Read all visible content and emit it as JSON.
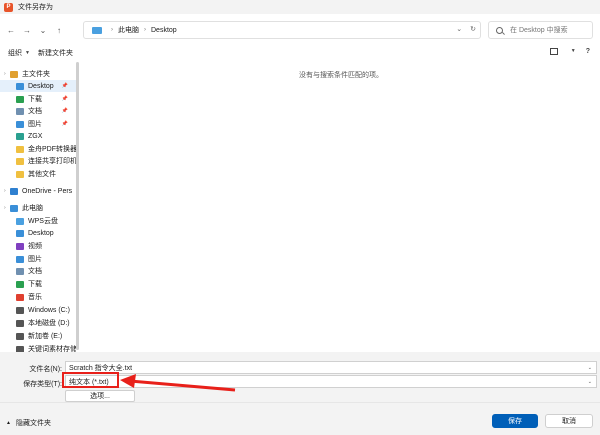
{
  "window": {
    "title": "文件另存为",
    "app_icon_letter": "P"
  },
  "nav": {
    "back": "←",
    "forward": "→",
    "dropdown": "⌄",
    "up": "↑",
    "breadcrumb": [
      "此电脑",
      "Desktop"
    ],
    "addr_dropdown": "⌄",
    "refresh": "↻",
    "search_placeholder": "在 Desktop 中搜索"
  },
  "toolbar": {
    "organize": "组织",
    "new_folder": "新建文件夹",
    "help": "?"
  },
  "sidebar": {
    "items": [
      {
        "label": "主文件夹",
        "icon": "home-icon",
        "color": "#e0a030"
      },
      {
        "label": "Desktop",
        "icon": "desktop-icon",
        "color": "#3a8fd8",
        "pinned": true,
        "selected": true
      },
      {
        "label": "下载",
        "icon": "download-icon",
        "color": "#2aa050",
        "pinned": true
      },
      {
        "label": "文档",
        "icon": "document-icon",
        "color": "#7090b0",
        "pinned": true
      },
      {
        "label": "图片",
        "icon": "pictures-icon",
        "color": "#3a8fd8",
        "pinned": true
      },
      {
        "label": "ZGX",
        "icon": "folder-icon",
        "color": "#2aa090"
      },
      {
        "label": "金舟PDF转换器",
        "icon": "folder-icon",
        "color": "#f0c040"
      },
      {
        "label": "连接共享打印机",
        "icon": "folder-icon",
        "color": "#f0c040"
      },
      {
        "label": "其他文件",
        "icon": "folder-icon",
        "color": "#f0c040"
      },
      {
        "label": "OneDrive - Pers",
        "icon": "onedrive-icon",
        "color": "#2f80d0"
      },
      {
        "label": "此电脑",
        "icon": "pc-icon",
        "color": "#3a8fd8"
      },
      {
        "label": "WPS云盘",
        "icon": "cloud-icon",
        "color": "#4aa0e0"
      },
      {
        "label": "Desktop",
        "icon": "desktop-icon",
        "color": "#3a8fd8"
      },
      {
        "label": "视频",
        "icon": "video-icon",
        "color": "#8040c0"
      },
      {
        "label": "图片",
        "icon": "pictures-icon",
        "color": "#3a8fd8"
      },
      {
        "label": "文档",
        "icon": "document-icon",
        "color": "#7090b0"
      },
      {
        "label": "下载",
        "icon": "download-icon",
        "color": "#2aa050"
      },
      {
        "label": "音乐",
        "icon": "music-icon",
        "color": "#e04030"
      },
      {
        "label": "Windows (C:)",
        "icon": "drive-icon",
        "color": "#555555"
      },
      {
        "label": "本地磁盘 (D:)",
        "icon": "drive-icon",
        "color": "#555555"
      },
      {
        "label": "新加卷 (E:)",
        "icon": "drive-icon",
        "color": "#555555"
      },
      {
        "label": "关键词素材存储",
        "icon": "drive-icon",
        "color": "#555555"
      }
    ],
    "pin_glyph": "📌",
    "chevron": "›"
  },
  "main": {
    "empty_message": "没有与搜索条件匹配的项。"
  },
  "form": {
    "filename_label": "文件名(N):",
    "filename_value": "Scratch 指令大全.txt",
    "filetype_label": "保存类型(T):",
    "filetype_value": "纯文本 (*.txt)",
    "options_label": "选项...",
    "caret": "⌄"
  },
  "footer": {
    "hide_folders": "隐藏文件夹",
    "save": "保存",
    "cancel": "取消"
  },
  "annotation": {
    "color": "#e8201a"
  }
}
